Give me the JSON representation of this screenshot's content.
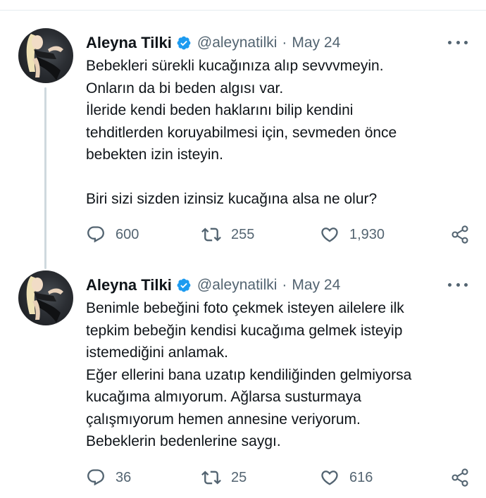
{
  "tweets": [
    {
      "author": {
        "name": "Aleyna Tilki",
        "handle": "@aleynatilki",
        "verified": true
      },
      "date": "May 24",
      "separator": "·",
      "lines": [
        "Bebekleri sürekli kucağınıza alıp sevvvmeyin.",
        "Onların da bi beden algısı var.",
        "İleride kendi beden haklarını bilip kendini",
        "tehditlerden koruyabilmesi için, sevmeden önce",
        "bebekten izin isteyin.",
        "",
        "Biri sizi sizden izinsiz kucağına alsa ne olur?"
      ],
      "stats": {
        "replies": "600",
        "retweets": "255",
        "likes": "1,930"
      }
    },
    {
      "author": {
        "name": "Aleyna Tilki",
        "handle": "@aleynatilki",
        "verified": true
      },
      "date": "May 24",
      "separator": "·",
      "lines": [
        "Benimle bebeğini foto çekmek isteyen ailelere ilk",
        "tepkim bebeğin kendisi kucağıma gelmek isteyip",
        "istemediğini anlamak.",
        "Eğer ellerini bana uzatıp kendiliğinden gelmiyorsa",
        "kucağıma almıyorum. Ağlarsa susturmaya",
        "çalışmıyorum hemen annesine veriyorum.",
        "Bebeklerin bedenlerine saygı."
      ],
      "stats": {
        "replies": "36",
        "retweets": "25",
        "likes": "616"
      }
    }
  ],
  "icons": {
    "verified": "verified-badge-icon",
    "more": "more-dots-icon",
    "reply": "reply-icon",
    "retweet": "retweet-icon",
    "like": "heart-icon",
    "share": "share-icon"
  },
  "colors": {
    "verified": "#1d9bf0",
    "text": "#0f1419",
    "secondary": "#536471",
    "thread_line": "#cfd9de",
    "divider": "#e6ecf0"
  }
}
